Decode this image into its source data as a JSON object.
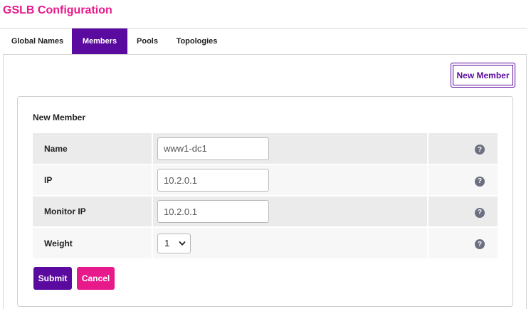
{
  "header": {
    "title": "GSLB Configuration"
  },
  "tabs": [
    {
      "label": "Global Names",
      "active": false
    },
    {
      "label": "Members",
      "active": true
    },
    {
      "label": "Pools",
      "active": false
    },
    {
      "label": "Topologies",
      "active": false
    }
  ],
  "toolbar": {
    "new_member_label": "New Member"
  },
  "form": {
    "title": "New Member",
    "fields": [
      {
        "label": "Name",
        "value": "www1-dc1",
        "help_icon": "question-circle-icon"
      },
      {
        "label": "IP",
        "value": "10.2.0.1",
        "help_icon": "question-circle-icon"
      },
      {
        "label": "Monitor IP",
        "value": "10.2.0.1",
        "help_icon": "question-circle-icon"
      },
      {
        "label": "Weight",
        "value": "1",
        "help_icon": "question-circle-icon"
      }
    ],
    "help_glyph": "?",
    "submit_label": "Submit",
    "cancel_label": "Cancel"
  },
  "colors": {
    "brand_pink": "#e8198b",
    "brand_purple": "#5a0a9e",
    "help_icon_gray": "#6b6f80"
  }
}
